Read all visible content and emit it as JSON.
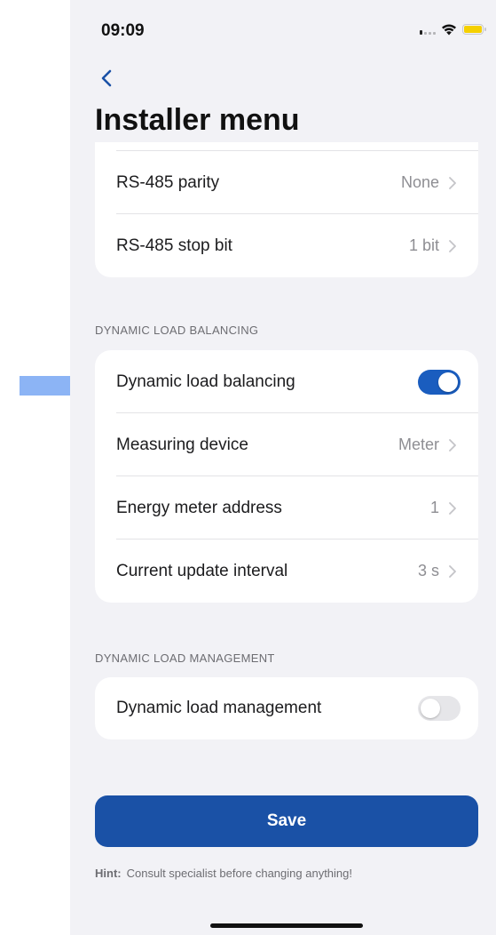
{
  "status_bar": {
    "time": "09:09"
  },
  "title": "Installer menu",
  "rs485_card": {
    "rows": [
      {
        "label": "RS-485 parity",
        "value": "None"
      },
      {
        "label": "RS-485 stop bit",
        "value": "1 bit"
      }
    ]
  },
  "dlb_section": {
    "header": "DYNAMIC LOAD BALANCING",
    "toggle_row": {
      "label": "Dynamic load balancing",
      "enabled": true
    },
    "rows": [
      {
        "label": "Measuring device",
        "value": "Meter"
      },
      {
        "label": "Energy meter address",
        "value": "1"
      },
      {
        "label": "Current update interval",
        "value": "3 s"
      }
    ]
  },
  "dlm_section": {
    "header": "DYNAMIC LOAD MANAGEMENT",
    "toggle_row": {
      "label": "Dynamic load management",
      "enabled": false
    }
  },
  "save_label": "Save",
  "hint": {
    "label": "Hint:",
    "text": "Consult specialist before changing anything!"
  },
  "colors": {
    "accent": "#1a51a6",
    "toggle_on": "#1a5dbf",
    "toggle_off": "#e6e6e9",
    "annotation_arrow": "#8cb4f5",
    "background": "#f2f2f6"
  },
  "icons": {
    "back": "chevron-left-icon",
    "row_disclosure": "chevron-right-icon",
    "annotation": "arrow-right-icon"
  }
}
